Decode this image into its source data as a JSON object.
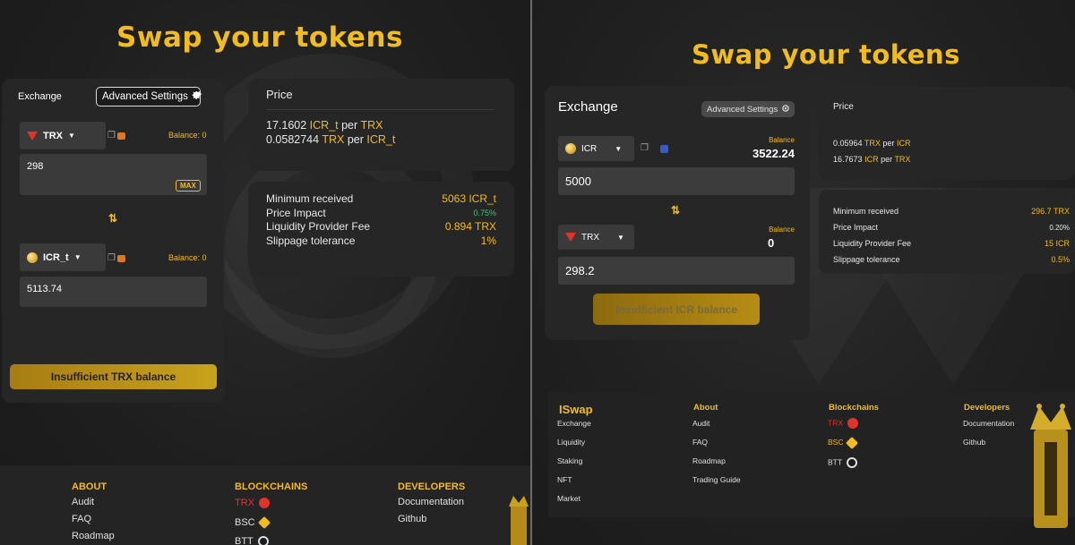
{
  "left": {
    "title": "Swap your tokens",
    "exchange_label": "Exchange",
    "advanced_settings": "Advanced Settings",
    "from": {
      "token": "TRX",
      "balance": "Balance: 0",
      "amount": "298",
      "max": "MAX"
    },
    "to": {
      "token": "ICR_t",
      "balance": "Balance: 0",
      "amount": "5113.74"
    },
    "action": "Insufficient TRX balance",
    "price": {
      "heading": "Price",
      "line1": {
        "value": "17.1602",
        "base": "ICR_t",
        "per": "per",
        "quote": "TRX"
      },
      "line2": {
        "value": "0.0582744",
        "base": "TRX",
        "per": "per",
        "quote": "ICR_t"
      }
    },
    "details": [
      {
        "label": "Minimum received",
        "value": "5063 ICR_t"
      },
      {
        "label": "Price Impact",
        "value": "0.75%"
      },
      {
        "label": "Liquidity Provider Fee",
        "value": "0.894 TRX"
      },
      {
        "label": "Slippage tolerance",
        "value": "1%"
      }
    ],
    "footer": {
      "about": {
        "heading": "ABOUT",
        "items": [
          "Audit",
          "FAQ",
          "Roadmap"
        ]
      },
      "blockchains": {
        "heading": "BLOCKCHAINS",
        "items": [
          "TRX",
          "BSC",
          "BTT"
        ]
      },
      "developers": {
        "heading": "DEVELOPERS",
        "items": [
          "Documentation",
          "Github"
        ]
      }
    }
  },
  "right": {
    "title": "Swap your tokens",
    "exchange_label": "Exchange",
    "advanced_settings": "Advanced Settings",
    "from": {
      "token": "ICR",
      "balance_label": "Balance",
      "balance": "3522.24",
      "amount": "5000"
    },
    "to": {
      "token": "TRX",
      "balance_label": "Balance",
      "balance": "0",
      "amount": "298.2"
    },
    "action": "Insufficient ICR balance",
    "price": {
      "heading": "Price",
      "line1": {
        "value": "0.05964",
        "base": "TRX",
        "per": "per",
        "quote": "ICR"
      },
      "line2": {
        "value": "16.7673",
        "base": "ICR",
        "per": "per",
        "quote": "TRX"
      }
    },
    "details": [
      {
        "label": "Minimum received",
        "value": "296.7 TRX"
      },
      {
        "label": "Price Impact",
        "value": "0.20%"
      },
      {
        "label": "Liquidity Provider Fee",
        "value": "15 ICR"
      },
      {
        "label": "Slippage tolerance",
        "value": "0.5%"
      }
    ],
    "footer": {
      "iswap": {
        "heading": "ISwap",
        "items": [
          "Exchange",
          "Liquidity",
          "Staking",
          "NFT",
          "Market"
        ]
      },
      "about": {
        "heading": "About",
        "items": [
          "Audit",
          "FAQ",
          "Roadmap",
          "Trading Guide"
        ]
      },
      "blockchains": {
        "heading": "Blockchains",
        "items": [
          "TRX",
          "BSC",
          "BTT"
        ]
      },
      "developers": {
        "heading": "Developers",
        "items": [
          "Documentation",
          "Github"
        ]
      }
    }
  },
  "icons": {
    "settings": "gear-icon",
    "chevron": "chevron-down-icon",
    "copy": "copy-icon",
    "wallet": "metamask-icon",
    "swap": "swap-arrows-icon"
  },
  "colors": {
    "accent": "#f2bc1c",
    "positive": "#3fc47a",
    "trx_red": "#e0342b",
    "card": "#262626"
  }
}
